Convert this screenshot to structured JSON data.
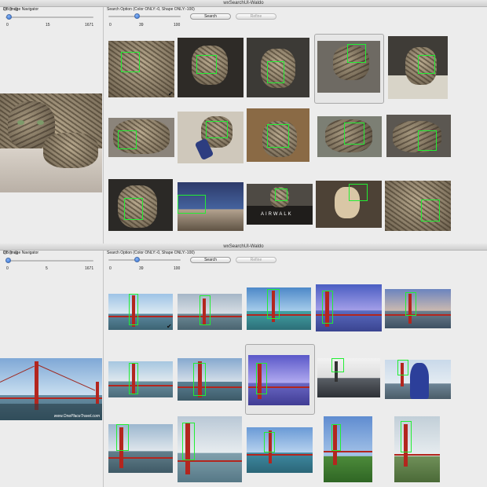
{
  "windows": [
    {
      "id": "top",
      "title": "wxSearchUI-Waldo",
      "navigator_label": "DB Image Navigator",
      "navigator_slider": {
        "min": "0",
        "value": "15",
        "max": "1671",
        "fraction": 0.009
      },
      "search_option_label": "Search Option (Color ONLY:-0, Shape ONLY:-100)",
      "option_slider": {
        "min": "0",
        "value": "39",
        "max": "100",
        "fraction": 0.39
      },
      "search_button": "Search",
      "refine_button": "Refine",
      "check_mark": "✔"
    },
    {
      "id": "bottom",
      "title": "wxSearchUI-Waldo",
      "navigator_label": "DB Image Navigator",
      "navigator_slider": {
        "min": "0",
        "value": "5",
        "max": "1671",
        "fraction": 0.003
      },
      "search_option_label": "Search Option (Color ONLY:-0, Shape ONLY:-100)",
      "option_slider": {
        "min": "0",
        "value": "39",
        "max": "100",
        "fraction": 0.39
      },
      "search_button": "Search",
      "refine_button": "Refine",
      "check_mark": "✔"
    }
  ],
  "preview_watermark": "www.OnePlaceTravel.com",
  "box_sign_text": "AIRWALK",
  "colors": {
    "detect_box": "#22ee33",
    "bridge_red": "#b3261e",
    "window_bg": "#ececec",
    "slider_knob": "#2f6fd6"
  }
}
